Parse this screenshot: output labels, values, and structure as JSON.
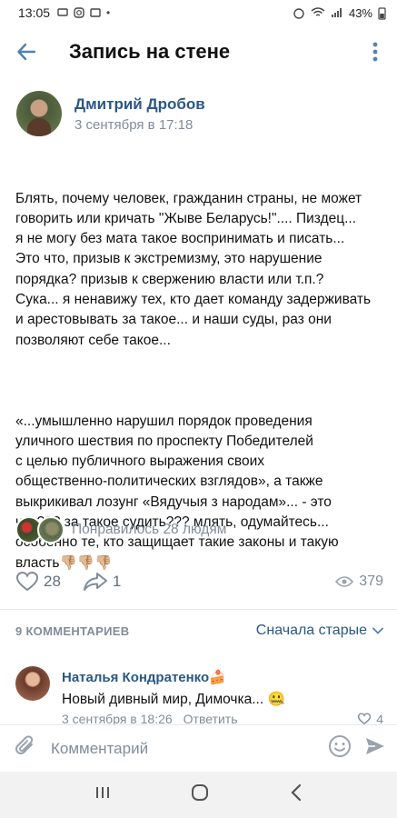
{
  "status_bar": {
    "time": "13:05",
    "battery": "43%"
  },
  "app_bar": {
    "title": "Запись на стене"
  },
  "post": {
    "author": "Дмитрий Дробов",
    "date": "3 сентября в 17:18",
    "paragraph_1": "Блять, почему человек, гражданин страны, не может\nговорить или кричать \"Жыве Беларусь!\".... Пиздец...\nя не могу без мата такое воспринимать и писать...\nЭто что, призыв к экстремизму, это нарушение\nпорядка? призыв к свержению власти или т.п.?\nСука... я ненавижу тех, кто дает команду задерживать\nи арестовывать за такое... и наши суды, раз они\nпозволяют себе такое...",
    "paragraph_2": "«...умышленно нарушил порядок проведения\nуличного шествия по проспекту Победителей\nс целью публичного выражения своих\nобщественно-политических взглядов», а также\nвыкрикивал лозунг «Вядучыя з народам»... - это\nчто??? за такое судить??? млять, одумайтесь...\nособенно те, кто защищает такие законы и такую\nвласть👎🏼👎🏼👎🏼",
    "likes_text": "Понравилось 28 людям",
    "likes_count": "28",
    "shares_count": "1",
    "views_count": "379"
  },
  "comments": {
    "header": "9 КОММЕНТАРИЕВ",
    "sort_label": "Сначала старые",
    "items": [
      {
        "author": "Наталья Кондратенко",
        "author_emoji": "🍰",
        "text": "Новый дивный мир, Димочка...",
        "text_emoji": "🤐",
        "date": "3 сентября в 18:26",
        "reply_label": "Ответить",
        "likes": "4"
      }
    ]
  },
  "composer": {
    "placeholder": "Комментарий"
  },
  "colors": {
    "link": "#2a5885",
    "secondary": "#818c99",
    "accent": "#5181b8"
  },
  "icons": [
    "back-arrow-icon",
    "more-vertical-icon",
    "heart-icon",
    "share-icon",
    "eye-icon",
    "chevron-down-icon",
    "paperclip-icon",
    "smile-icon",
    "send-icon",
    "recent-apps-icon",
    "home-icon",
    "nav-back-icon"
  ]
}
